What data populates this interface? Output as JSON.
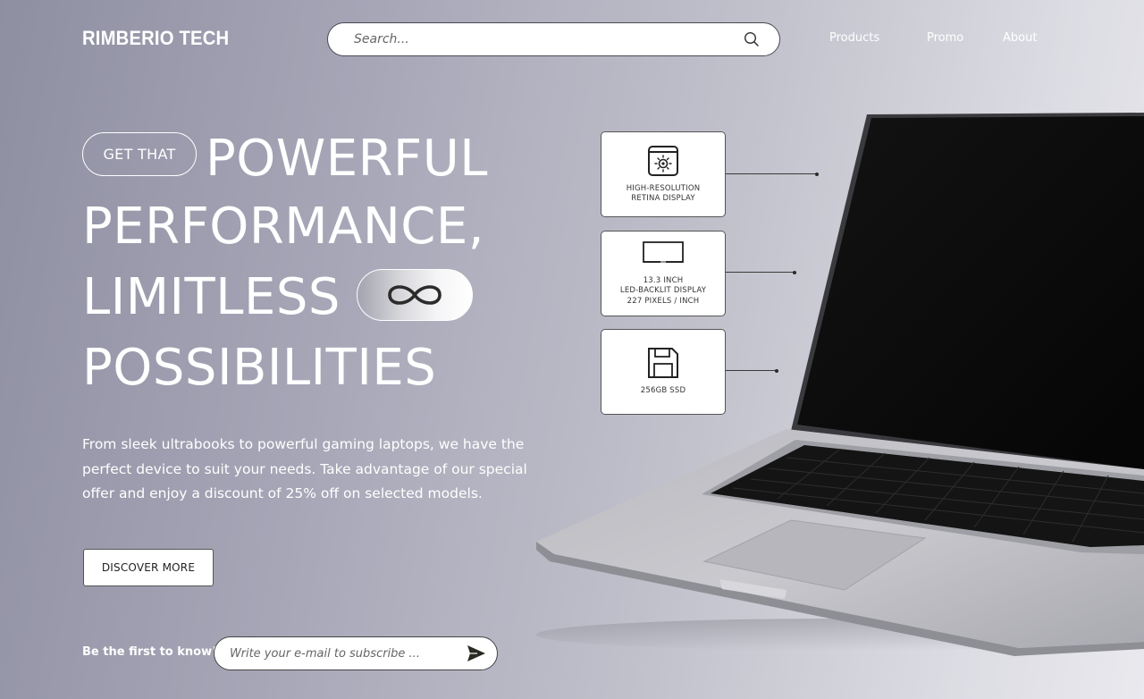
{
  "brand": {
    "name": "RIMBERIO TECH"
  },
  "search": {
    "placeholder": "Search...",
    "icon": "search-icon"
  },
  "nav": {
    "items": [
      "Products",
      "Promo",
      "About"
    ]
  },
  "hero": {
    "pill": "GET THAT",
    "line1": "POWERFUL",
    "line2": "PERFORMANCE,",
    "line3": "LIMITLESS",
    "line4": "POSSIBILITIES",
    "infinity_icon": "infinity-icon",
    "description": "From sleek ultrabooks to powerful gaming laptops, we have the perfect device to suit your needs. Take advantage of our special offer and enjoy a discount of 25% off on selected models.",
    "cta": "DISCOVER MORE"
  },
  "subscribe": {
    "label": "Be the first to know!",
    "placeholder": "Write your e-mail to subscribe ...",
    "icon": "send-icon"
  },
  "features": [
    {
      "icon": "retina-display-icon",
      "line1": "HIGH-RESOLUTION",
      "line2": "RETINA DISPLAY"
    },
    {
      "icon": "monitor-icon",
      "line1": "13.3 INCH",
      "line2": "LED-BACKLIT DISPLAY",
      "line3": "227 PIXELS / INCH"
    },
    {
      "icon": "floppy-disk-icon",
      "line1": "256GB SSD"
    }
  ],
  "colors": {
    "accent": "#ffffff",
    "dark": "#1a1a1a"
  }
}
